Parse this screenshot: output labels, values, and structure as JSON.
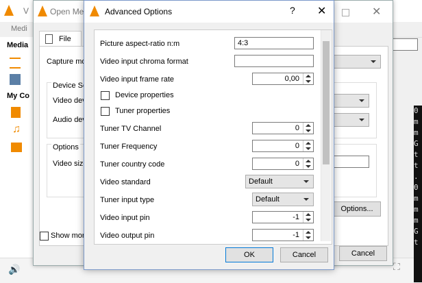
{
  "vlc": {
    "title": "V",
    "menu_first": "Medi",
    "sidebar": {
      "heading1": "Media",
      "heading2": "My Co"
    },
    "capture_mode_label": "Capture mo",
    "device_section": "Device Se",
    "video_device_label": "Video dev",
    "audio_device_label": "Audio dev",
    "options_label": "Options",
    "video_size_label": "Video size",
    "show_more": "Show more",
    "more_options_button": "Options...",
    "cancel_button": "Cancel",
    "terminal_chars": [
      "0",
      "m",
      "m",
      "G",
      "t",
      "t",
      ".",
      "0",
      "m",
      "m",
      "m",
      "G",
      "t"
    ]
  },
  "open_media": {
    "title": "Open Me",
    "file_tab": "File"
  },
  "advanced": {
    "title": "Advanced Options",
    "help_label": "?",
    "close_label": "✕",
    "rows": [
      {
        "label": "Picture aspect-ratio n:m",
        "value": "4:3"
      },
      {
        "label": "Video input chroma format",
        "value": ""
      },
      {
        "label": "Video input frame rate",
        "value": "0,00"
      },
      {
        "label": "Device properties",
        "checked": false
      },
      {
        "label": "Tuner properties",
        "checked": false
      },
      {
        "label": "Tuner TV Channel",
        "value": "0"
      },
      {
        "label": "Tuner Frequency",
        "value": "0"
      },
      {
        "label": "Tuner country code",
        "value": "0"
      },
      {
        "label": "Video standard",
        "value": "Default"
      },
      {
        "label": "Tuner input type",
        "value": "Default"
      },
      {
        "label": "Video input pin",
        "value": "-1"
      },
      {
        "label": "Video output pin",
        "value": "-1"
      }
    ],
    "ok_label": "OK",
    "cancel_label": "Cancel"
  },
  "colors": {
    "vlc_orange": "#f08a00",
    "accent_blue": "#0078d7"
  }
}
